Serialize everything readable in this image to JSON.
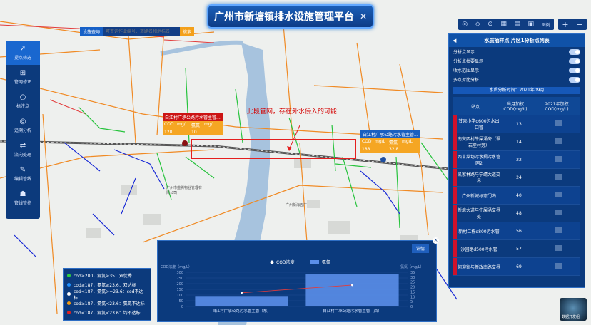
{
  "app": {
    "title": "广州市新塘镇排水设施管理平台",
    "close_glyph": "✕"
  },
  "search": {
    "type_label": "设施查询",
    "placeholder": "可查询作业编号、道路名和地标名",
    "go_label": "搜索"
  },
  "toolbar": {
    "icons": [
      "◎",
      "◇",
      "⊙",
      "▦",
      "▤",
      "▣"
    ],
    "map_label": "图例",
    "plus": "+",
    "minus": "−"
  },
  "sidebar": {
    "items": [
      {
        "label": "提点筛选",
        "icon": "rocket-icon"
      },
      {
        "label": "管网修正",
        "icon": "pipe-icon"
      },
      {
        "label": "标注点",
        "icon": "ring-icon"
      },
      {
        "label": "追溯分析",
        "icon": "target-icon"
      },
      {
        "label": "流向处理",
        "icon": "flow-icon"
      },
      {
        "label": "编辑管线",
        "icon": "edit-icon"
      },
      {
        "label": "管线管控",
        "icon": "person-icon"
      }
    ]
  },
  "right_panel": {
    "title": "水质抽样点 片区1分析点列表",
    "toggles": [
      "分析点显示",
      "分析点抽要显示",
      "收水范围显示",
      "多点对比分析"
    ],
    "month_label": "水质分析时间：2021年09月",
    "columns": [
      "站点",
      "当月加权COD(mg/L)",
      "2021年加权COD(mg/L)"
    ],
    "rows": [
      {
        "name": "甘泉小学d600污水出口管",
        "month": "13"
      },
      {
        "name": "南安西村牛屎涌旁（翠岩堡村旁）",
        "month": "14"
      },
      {
        "name": "西草菜场污水揭污水管网2",
        "month": "22"
      },
      {
        "name": "凯家林路与宁靖大道交界",
        "month": "24"
      },
      {
        "name": "广州新城标志门内",
        "month": "40"
      },
      {
        "name": "新塘大道与牛屎涌交界处",
        "month": "48"
      },
      {
        "name": "新村二栋d800污水管",
        "month": "56"
      },
      {
        "name": "沙园路d500污水管",
        "month": "57"
      },
      {
        "name": "何迎街与新政南路交界",
        "month": "69"
      }
    ]
  },
  "legend": {
    "items": [
      {
        "label": "cod≥200，氨氮≥35：双优秀",
        "color": "#2ecc40"
      },
      {
        "label": "cod≥187，氨氮≥23.6：双达标",
        "color": "#1e90ff"
      },
      {
        "label": "cod<187，氨氮>=23.6：cod不达标",
        "color": "#ffffff"
      },
      {
        "label": "cod≥187，氨氮<23.6：氨氮不达标",
        "color": "#f39c12"
      },
      {
        "label": "cod<187，氨氮<23.6：均不达标",
        "color": "#e02020"
      }
    ]
  },
  "annotation": "此段管网，存在外水侵入的可能",
  "flags": [
    {
      "title": "白江村广承公路污水管主管...",
      "cod_label": "COD",
      "cod_unit": "mg/L",
      "cod_value": "120",
      "nh_label": "氨氮",
      "nh_unit": "mg/L",
      "nh_value": "10",
      "color": "red"
    },
    {
      "title": "白江村广承公路污水管主管...",
      "cod_label": "COD",
      "cod_unit": "mg/L",
      "cod_value": "188",
      "nh_label": "氨氮",
      "nh_unit": "mg/L",
      "nh_value": "32.8",
      "color": "blue"
    }
  ],
  "map_labels": {
    "place1": "广州市盛腾物业管理有限公司",
    "place2": "广州新海五厂"
  },
  "chart_panel": {
    "detail_label": "详情",
    "close_glyph": "×"
  },
  "chart_data": {
    "type": "bar",
    "categories": [
      "白江村广承公路污水管主管（东）",
      "白江村广承公路污水管主管（西）"
    ],
    "series": [
      {
        "name": "COD浓度",
        "type": "line",
        "axis": "left",
        "values": [
          120,
          188
        ]
      },
      {
        "name": "氨氮",
        "type": "bar",
        "axis": "right",
        "values": [
          10,
          32.8
        ]
      }
    ],
    "ylabel": "COD浓度（mg/L）",
    "y2label": "氨氮（mg/L）",
    "ylim": [
      0,
      300
    ],
    "y2lim": [
      0,
      35
    ],
    "yticks": [
      0,
      50,
      100,
      150,
      200,
      250,
      300
    ],
    "y2ticks": [
      0,
      5,
      10,
      15,
      20,
      25,
      30,
      35
    ]
  },
  "logo3d": {
    "label": "数据开发组"
  }
}
